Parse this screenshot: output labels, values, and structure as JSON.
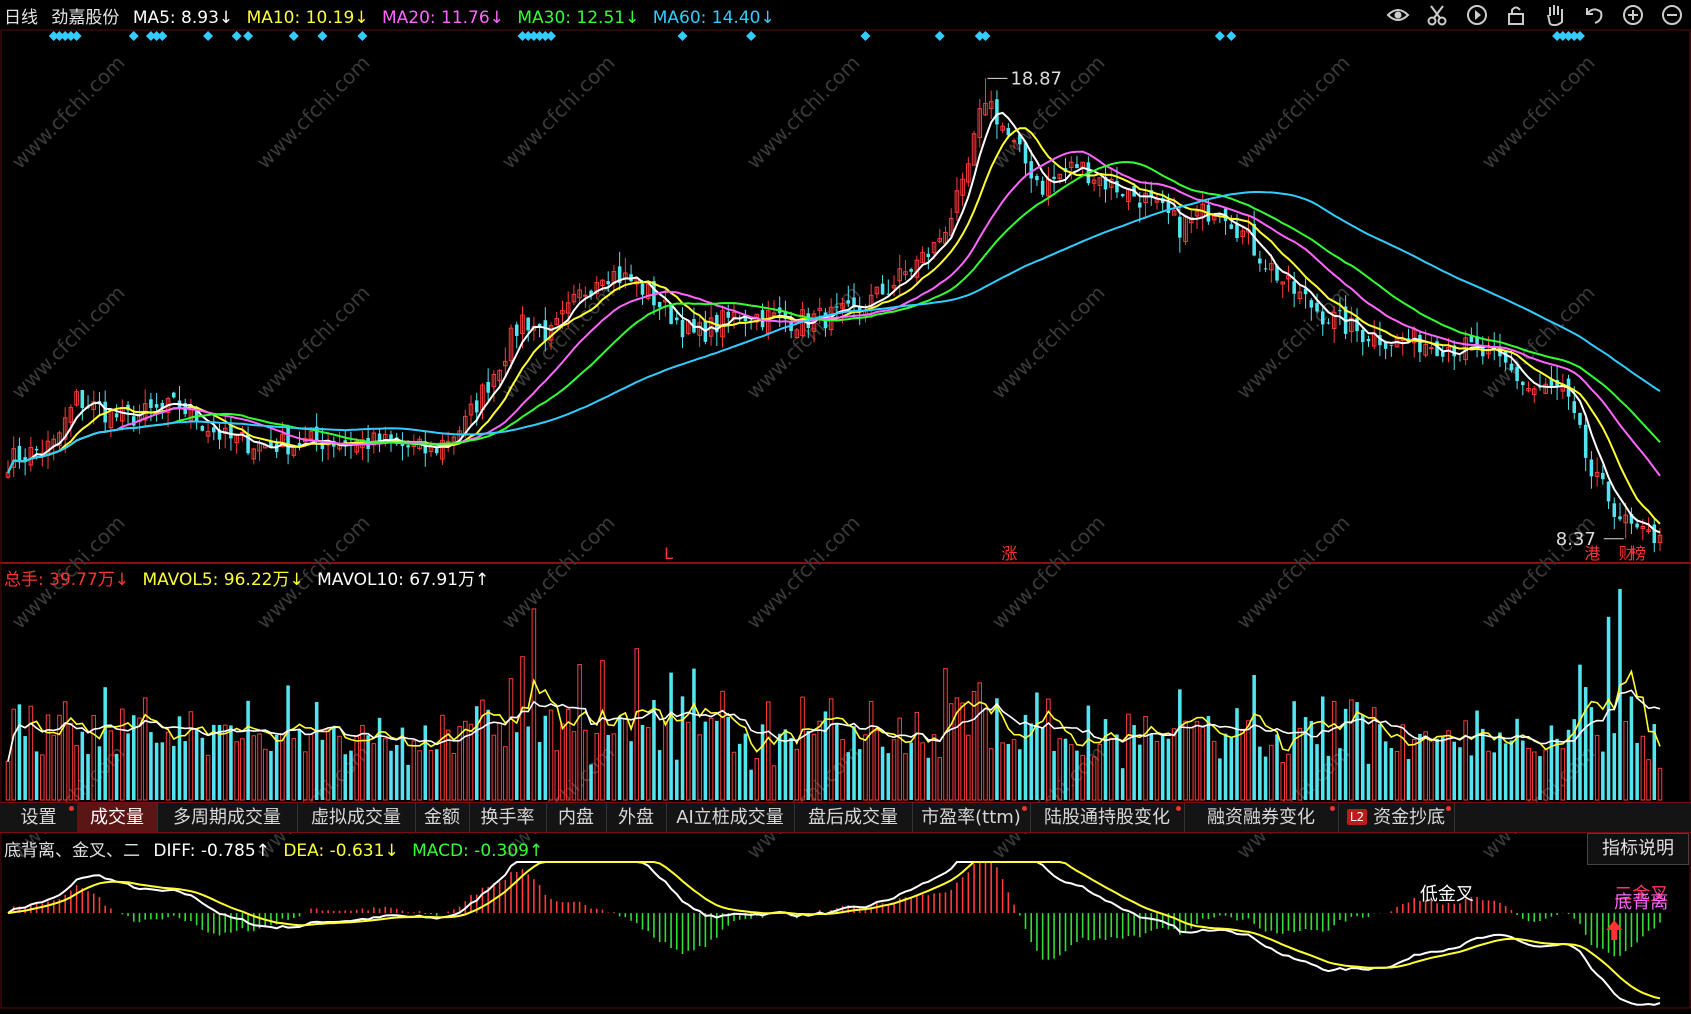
{
  "header": {
    "period": "日线",
    "stock_name": "劲嘉股份",
    "ma": [
      {
        "label": "MA5: 8.93↓",
        "color": "#ffffff"
      },
      {
        "label": "MA10: 10.19↓",
        "color": "#ffff33"
      },
      {
        "label": "MA20: 11.76↓",
        "color": "#ff66ff"
      },
      {
        "label": "MA30: 12.51↓",
        "color": "#33ff33"
      },
      {
        "label": "MA60: 14.40↓",
        "color": "#33ccff"
      }
    ]
  },
  "toolbar_icons": [
    "eye-icon",
    "scissors-icon",
    "play-icon",
    "lock-icon",
    "hand-icon",
    "undo-icon",
    "zoom-in-icon",
    "zoom-out-icon"
  ],
  "price_labels": {
    "high": "18.87",
    "low": "8.37"
  },
  "event_markers": [
    {
      "text": "L",
      "index": 116
    },
    {
      "text": "涨",
      "index": 175
    },
    {
      "text": "港",
      "index": 277
    },
    {
      "text": "财",
      "index": 283
    },
    {
      "text": "榜",
      "index": 285
    }
  ],
  "volume_header": [
    {
      "label": "总手: 39.77万↓",
      "color": "#ff3333"
    },
    {
      "label": "MAVOL5: 96.22万↓",
      "color": "#ffff33"
    },
    {
      "label": "MAVOL10: 67.91万↑",
      "color": "#ffffff"
    }
  ],
  "tabs": [
    {
      "label": "设置",
      "dot": true
    },
    {
      "label": "成交量",
      "active": true
    },
    {
      "label": "多周期成交量"
    },
    {
      "label": "虚拟成交量"
    },
    {
      "label": "金额"
    },
    {
      "label": "换手率"
    },
    {
      "label": "内盘"
    },
    {
      "label": "外盘"
    },
    {
      "label": "AI立桩成交量"
    },
    {
      "label": "盘后成交量"
    },
    {
      "label": "市盈率(ttm)",
      "dot": true
    },
    {
      "label": "陆股通持股变化",
      "dot": true
    },
    {
      "label": "融资融券变化",
      "dot": true
    },
    {
      "label": "资金抄底",
      "dot": true,
      "badge": "L2"
    }
  ],
  "macd_header": [
    {
      "label": "底背离、金叉、二",
      "color": "#e0e0e0"
    },
    {
      "label": "DIFF: -0.785↑",
      "color": "#ffffff"
    },
    {
      "label": "DEA: -0.631↓",
      "color": "#ffff33"
    },
    {
      "label": "MACD: -0.309↑",
      "color": "#33ff33"
    }
  ],
  "help_button": "指标说明",
  "macd_annotations": [
    {
      "text": "低金叉",
      "color": "#ffffff",
      "index": 247
    },
    {
      "text": "二金叉",
      "color": "#ff3366",
      "index": 281
    },
    {
      "text": "底背离",
      "color": "#ff66ff",
      "index": 281
    }
  ],
  "watermark": "www.cfchi.com",
  "chart_data": {
    "type": "candlestick",
    "title": "劲嘉股份 日线",
    "bar_count": 290,
    "price_range": [
      8.0,
      19.7
    ],
    "anchors": [
      [
        0,
        10.15
      ],
      [
        8,
        10.5
      ],
      [
        12,
        11.55
      ],
      [
        20,
        11.1
      ],
      [
        30,
        11.4
      ],
      [
        38,
        10.65
      ],
      [
        45,
        10.5
      ],
      [
        55,
        10.6
      ],
      [
        66,
        10.55
      ],
      [
        74,
        10.35
      ],
      [
        80,
        11.0
      ],
      [
        86,
        12.4
      ],
      [
        90,
        13.4
      ],
      [
        95,
        13.0
      ],
      [
        100,
        13.9
      ],
      [
        104,
        14.5
      ],
      [
        110,
        14.2
      ],
      [
        115,
        13.6
      ],
      [
        120,
        13.0
      ],
      [
        128,
        13.5
      ],
      [
        138,
        13.35
      ],
      [
        148,
        13.5
      ],
      [
        155,
        14.2
      ],
      [
        162,
        15.0
      ],
      [
        167,
        16.3
      ],
      [
        171,
        18.5
      ],
      [
        176,
        17.3
      ],
      [
        181,
        16.4
      ],
      [
        187,
        16.9
      ],
      [
        192,
        16.5
      ],
      [
        199,
        16.1
      ],
      [
        205,
        15.5
      ],
      [
        212,
        16.0
      ],
      [
        218,
        15.0
      ],
      [
        224,
        14.1
      ],
      [
        230,
        13.5
      ],
      [
        236,
        13.1
      ],
      [
        242,
        12.9
      ],
      [
        248,
        12.85
      ],
      [
        256,
        12.7
      ],
      [
        262,
        12.3
      ],
      [
        266,
        11.8
      ],
      [
        272,
        11.75
      ],
      [
        275,
        10.7
      ],
      [
        277,
        9.8
      ],
      [
        280,
        9.3
      ],
      [
        283,
        8.7
      ],
      [
        286,
        8.4
      ],
      [
        289,
        8.45
      ]
    ],
    "ma_series": [
      {
        "name": "MA5",
        "period": 5,
        "color": "#ffffff"
      },
      {
        "name": "MA10",
        "period": 10,
        "color": "#ffff33"
      },
      {
        "name": "MA20",
        "period": 20,
        "color": "#ff66ff"
      },
      {
        "name": "MA30",
        "period": 30,
        "color": "#33ff33"
      },
      {
        "name": "MA60",
        "period": 60,
        "color": "#33ccff"
      }
    ],
    "volume": {
      "unit": "万",
      "max": 270,
      "last": 39.77,
      "mavol5": 96.22,
      "mavol10": 67.91,
      "spikes": [
        [
          90,
          180
        ],
        [
          92,
          240
        ],
        [
          100,
          170
        ],
        [
          104,
          175
        ],
        [
          110,
          190
        ],
        [
          116,
          160
        ],
        [
          120,
          165
        ],
        [
          164,
          165
        ],
        [
          180,
          135
        ],
        [
          230,
          130
        ],
        [
          275,
          170
        ],
        [
          280,
          230
        ],
        [
          282,
          265
        ],
        [
          284,
          130
        ],
        [
          286,
          80
        ]
      ]
    },
    "macd": {
      "diff": -0.785,
      "dea": -0.631,
      "macd": -0.309,
      "range": [
        -1.0,
        0.55
      ]
    },
    "diamond_indices": [
      8,
      9,
      10,
      11,
      12,
      22,
      25,
      26,
      27,
      35,
      40,
      42,
      50,
      55,
      62,
      90,
      91,
      92,
      93,
      94,
      95,
      118,
      130,
      150,
      163,
      170,
      171,
      212,
      214,
      271,
      272,
      273,
      274,
      275
    ]
  }
}
